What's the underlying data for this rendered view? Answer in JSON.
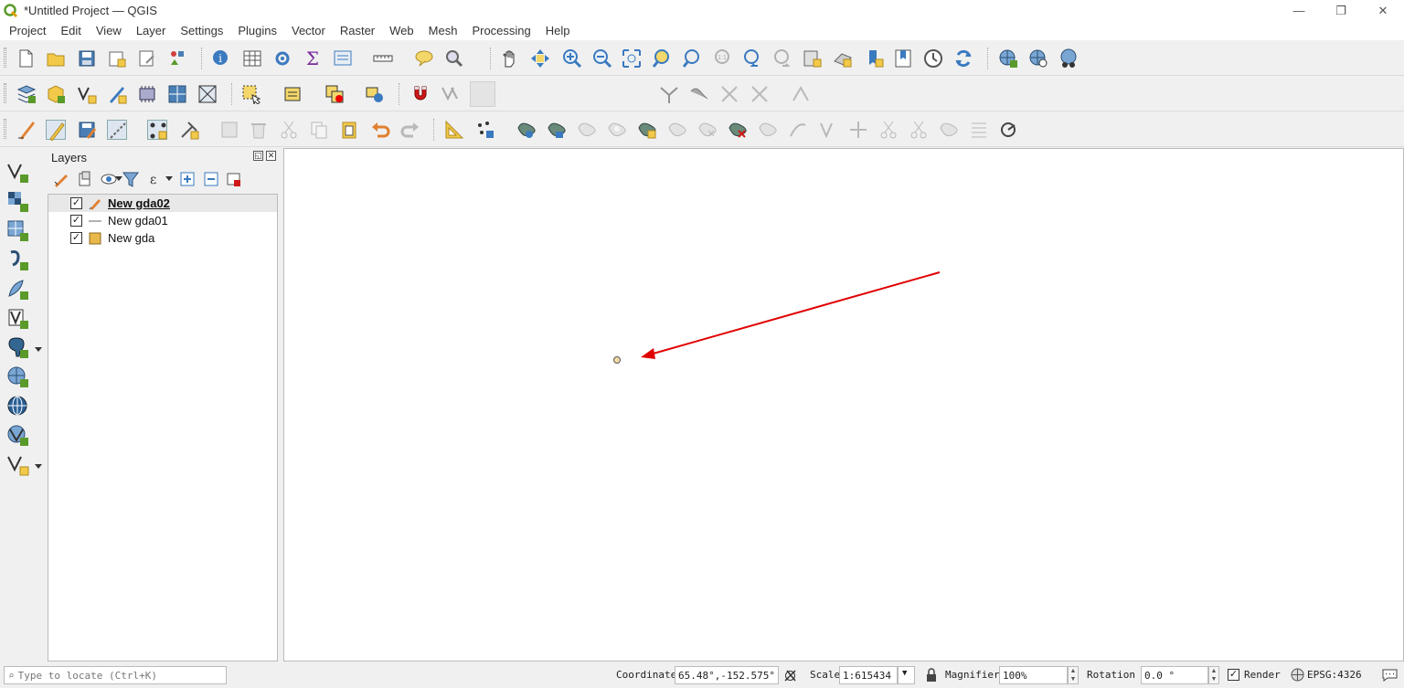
{
  "window": {
    "title": "*Untitled Project — QGIS",
    "minimize": "—",
    "restore": "❐",
    "close": "✕"
  },
  "menubar": {
    "items": [
      "Project",
      "Edit",
      "View",
      "Layer",
      "Settings",
      "Plugins",
      "Vector",
      "Raster",
      "Web",
      "Mesh",
      "Processing",
      "Help"
    ]
  },
  "toolbar2": {
    "font_size_value": "12",
    "font_unit": "px"
  },
  "layers_panel": {
    "title": "Layers",
    "float_btn": "◱",
    "close_btn": "✕",
    "layers": [
      {
        "name": "New gda02",
        "checked": "✓",
        "type": "point",
        "active": true
      },
      {
        "name": "New gda01",
        "checked": "✓",
        "type": "line",
        "active": false
      },
      {
        "name": "New gda",
        "checked": "✓",
        "type": "polygon",
        "active": false
      }
    ]
  },
  "canvas": {
    "annotation": "red arrow pointing at a point feature"
  },
  "statusbar": {
    "locator_placeholder": "Type to locate (Ctrl+K)",
    "coordinate_label": "Coordinate",
    "coordinate_value": "65.48°,-152.575°",
    "scale_label": "Scale",
    "scale_value": "1:615434",
    "magnifier_label": "Magnifier",
    "magnifier_value": "100%",
    "rotation_label": "Rotation",
    "rotation_value": "0.0 °",
    "render_label": "Render",
    "render_checked": "✓",
    "crs": "EPSG:4326"
  },
  "colors": {
    "accent": "#3a7abf",
    "arrow": "#e00000",
    "point_fill": "#f2dca8",
    "polygon_fill": "#e8b84a"
  }
}
